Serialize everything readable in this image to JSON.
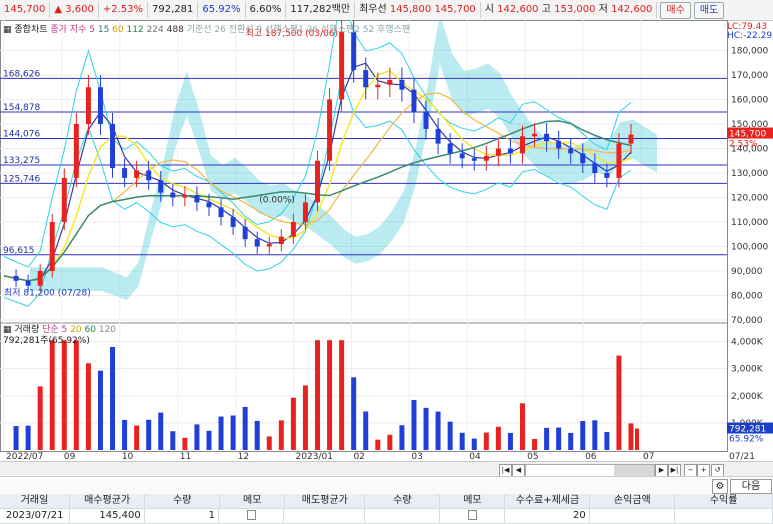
{
  "topbar": {
    "price": "145,700",
    "change_arrow": "▲",
    "change": "3,600",
    "change_pct": "+2.53%",
    "volume": "792,281",
    "volume_ratio": "65.92%",
    "turnover": "6.60%",
    "amount": "117,282백만",
    "preferred_label": "최우선",
    "best_ask": "145,800",
    "best_bid": "145,700",
    "open_label": "시",
    "open": "142,600",
    "high_label": "고",
    "high": "153,000",
    "low_label": "저",
    "low": "142,600",
    "buy_label": "매수",
    "sell_label": "매도"
  },
  "legend": {
    "price_title": "종합차트",
    "ma_label": "종가 지수 5",
    "ma_periods": [
      "15",
      "60",
      "112",
      "224",
      "488"
    ],
    "ichimoku_label": "기준선 26  전환선 9  선행스팬1 26  선행스팬2 52  후행스팬",
    "volume_title": "거래량",
    "vol_ma_label": "단순 5",
    "vol_ma_periods": [
      "20",
      "60",
      "120"
    ],
    "volume_value": "792,281주(65.92%)",
    "lc_label": "LC:79.43",
    "hc_label": "HC:-22.29"
  },
  "annotations": {
    "high_marker": "최고 187,500 (03/06)",
    "low_marker": "최저 81,200 (07/28)",
    "mid_marker": "(0.00%)"
  },
  "right_axis": {
    "price_ticks": [
      "180,000",
      "170,000",
      "160,000",
      "150,000",
      "140,000",
      "130,000",
      "120,000",
      "110,000",
      "100,000",
      "90,000",
      "80,000",
      "70,000"
    ],
    "current_price_badge": "145,700",
    "current_change_badge": "2.53%",
    "volume_ticks": [
      "4,000K",
      "3,000K",
      "2,000K",
      "1,000K"
    ],
    "volume_badge": "792,281",
    "volume_pct_badge": "65.92%"
  },
  "levels": [
    "168,626",
    "154,878",
    "144,076",
    "133,275",
    "125,746",
    "96,615"
  ],
  "x_axis": {
    "labels": [
      "2022/07",
      "09",
      "10",
      "11",
      "12",
      "2023/01",
      "02",
      "03",
      "04",
      "05",
      "06",
      "07"
    ],
    "end_label": "07/21"
  },
  "toolbar": {
    "next_label": "다음"
  },
  "colors": {
    "candle_up": "#e8231f",
    "candle_down": "#1f3fd8",
    "cloud": "#39c6d8",
    "ma5": "#3a3aa0",
    "ma15": "#f5e82a",
    "ma60": "#f2b844",
    "ma224": "#3a8a6c",
    "band": "#2ed3e8",
    "level": "#3030c0"
  },
  "table": {
    "headers": [
      "거래일",
      "매수평균가",
      "수량",
      "메모",
      "매도평균가",
      "수량",
      "메모",
      "수수료+제세금",
      "손익금액",
      "수익률"
    ],
    "rows": [
      [
        "2023/07/21",
        "145,400",
        "1",
        "",
        "",
        "",
        "",
        "20",
        "",
        ""
      ]
    ]
  },
  "chart_data": {
    "type": "candlestick",
    "title": "",
    "x": [
      "2022/07",
      "09",
      "10",
      "11",
      "12",
      "2023/01",
      "02",
      "03",
      "04",
      "05",
      "06",
      "07"
    ],
    "price_ylim": [
      70000,
      190000
    ],
    "volume_ylim": [
      0,
      4500000
    ],
    "horizontal_levels": [
      168626,
      154878,
      144076,
      133275,
      125746,
      96615
    ],
    "close_path": [
      88000,
      86000,
      84000,
      90000,
      110000,
      128000,
      150000,
      165000,
      150000,
      132000,
      128000,
      131000,
      127000,
      122000,
      120000,
      121000,
      118000,
      116000,
      112000,
      108000,
      103000,
      100000,
      101000,
      104000,
      110000,
      118000,
      135000,
      160000,
      187500,
      172000,
      165000,
      166000,
      168000,
      164000,
      155000,
      148000,
      142000,
      138000,
      136000,
      135000,
      137000,
      140000,
      138000,
      145000,
      146000,
      143000,
      140000,
      138000,
      134000,
      130000,
      128000,
      142000,
      145700
    ],
    "high": 187500,
    "high_date": "03/06",
    "low": 81200,
    "low_date": "07/28",
    "last_close": 145700,
    "last_volume": 792281
  }
}
